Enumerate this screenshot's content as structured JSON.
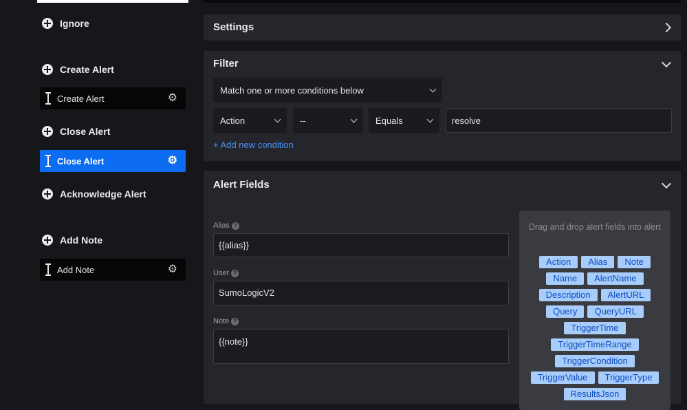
{
  "sidebar": {
    "actions": [
      {
        "header": "Ignore",
        "items": []
      },
      {
        "header": "Create Alert",
        "items": [
          {
            "label": "Create Alert",
            "active": false
          }
        ]
      },
      {
        "header": "Close Alert",
        "items": [
          {
            "label": "Close Alert",
            "active": true
          }
        ]
      },
      {
        "header": "Acknowledge Alert",
        "items": []
      },
      {
        "header": "Add Note",
        "items": [
          {
            "label": "Add Note",
            "active": false
          }
        ]
      }
    ]
  },
  "settings": {
    "title": "Settings"
  },
  "filter": {
    "title": "Filter",
    "match_mode": "Match one or more conditions below",
    "condition": {
      "field": "Action",
      "operator_not": "--",
      "operator": "Equals",
      "value": "resolve"
    },
    "add_condition": "+ Add new condition"
  },
  "alert_fields": {
    "title": "Alert Fields",
    "alias": {
      "label": "Alias",
      "value": "{{alias}}"
    },
    "user": {
      "label": "User",
      "value": "SumoLogicV2"
    },
    "note": {
      "label": "Note",
      "value": "{{note}}"
    },
    "dnd_hint": "Drag and drop alert fields into alert",
    "chips": [
      "Action",
      "Alias",
      "Note",
      "Name",
      "AlertName",
      "Description",
      "AlertURL",
      "Query",
      "QueryURL",
      "TriggerTime",
      "TriggerTimeRange",
      "TriggerCondition",
      "TriggerValue",
      "TriggerType",
      "ResultsJson"
    ]
  },
  "colors": {
    "accent": "#0c6cf2",
    "chip_bg": "#a9cdfa",
    "chip_text": "#0e4fbf",
    "link": "#4a93f6"
  },
  "icons": {
    "header": "plus-circle-icon",
    "item_drag": "drag-handle-icon",
    "item_settings": "gear-icon",
    "help": "question-circle-icon"
  }
}
